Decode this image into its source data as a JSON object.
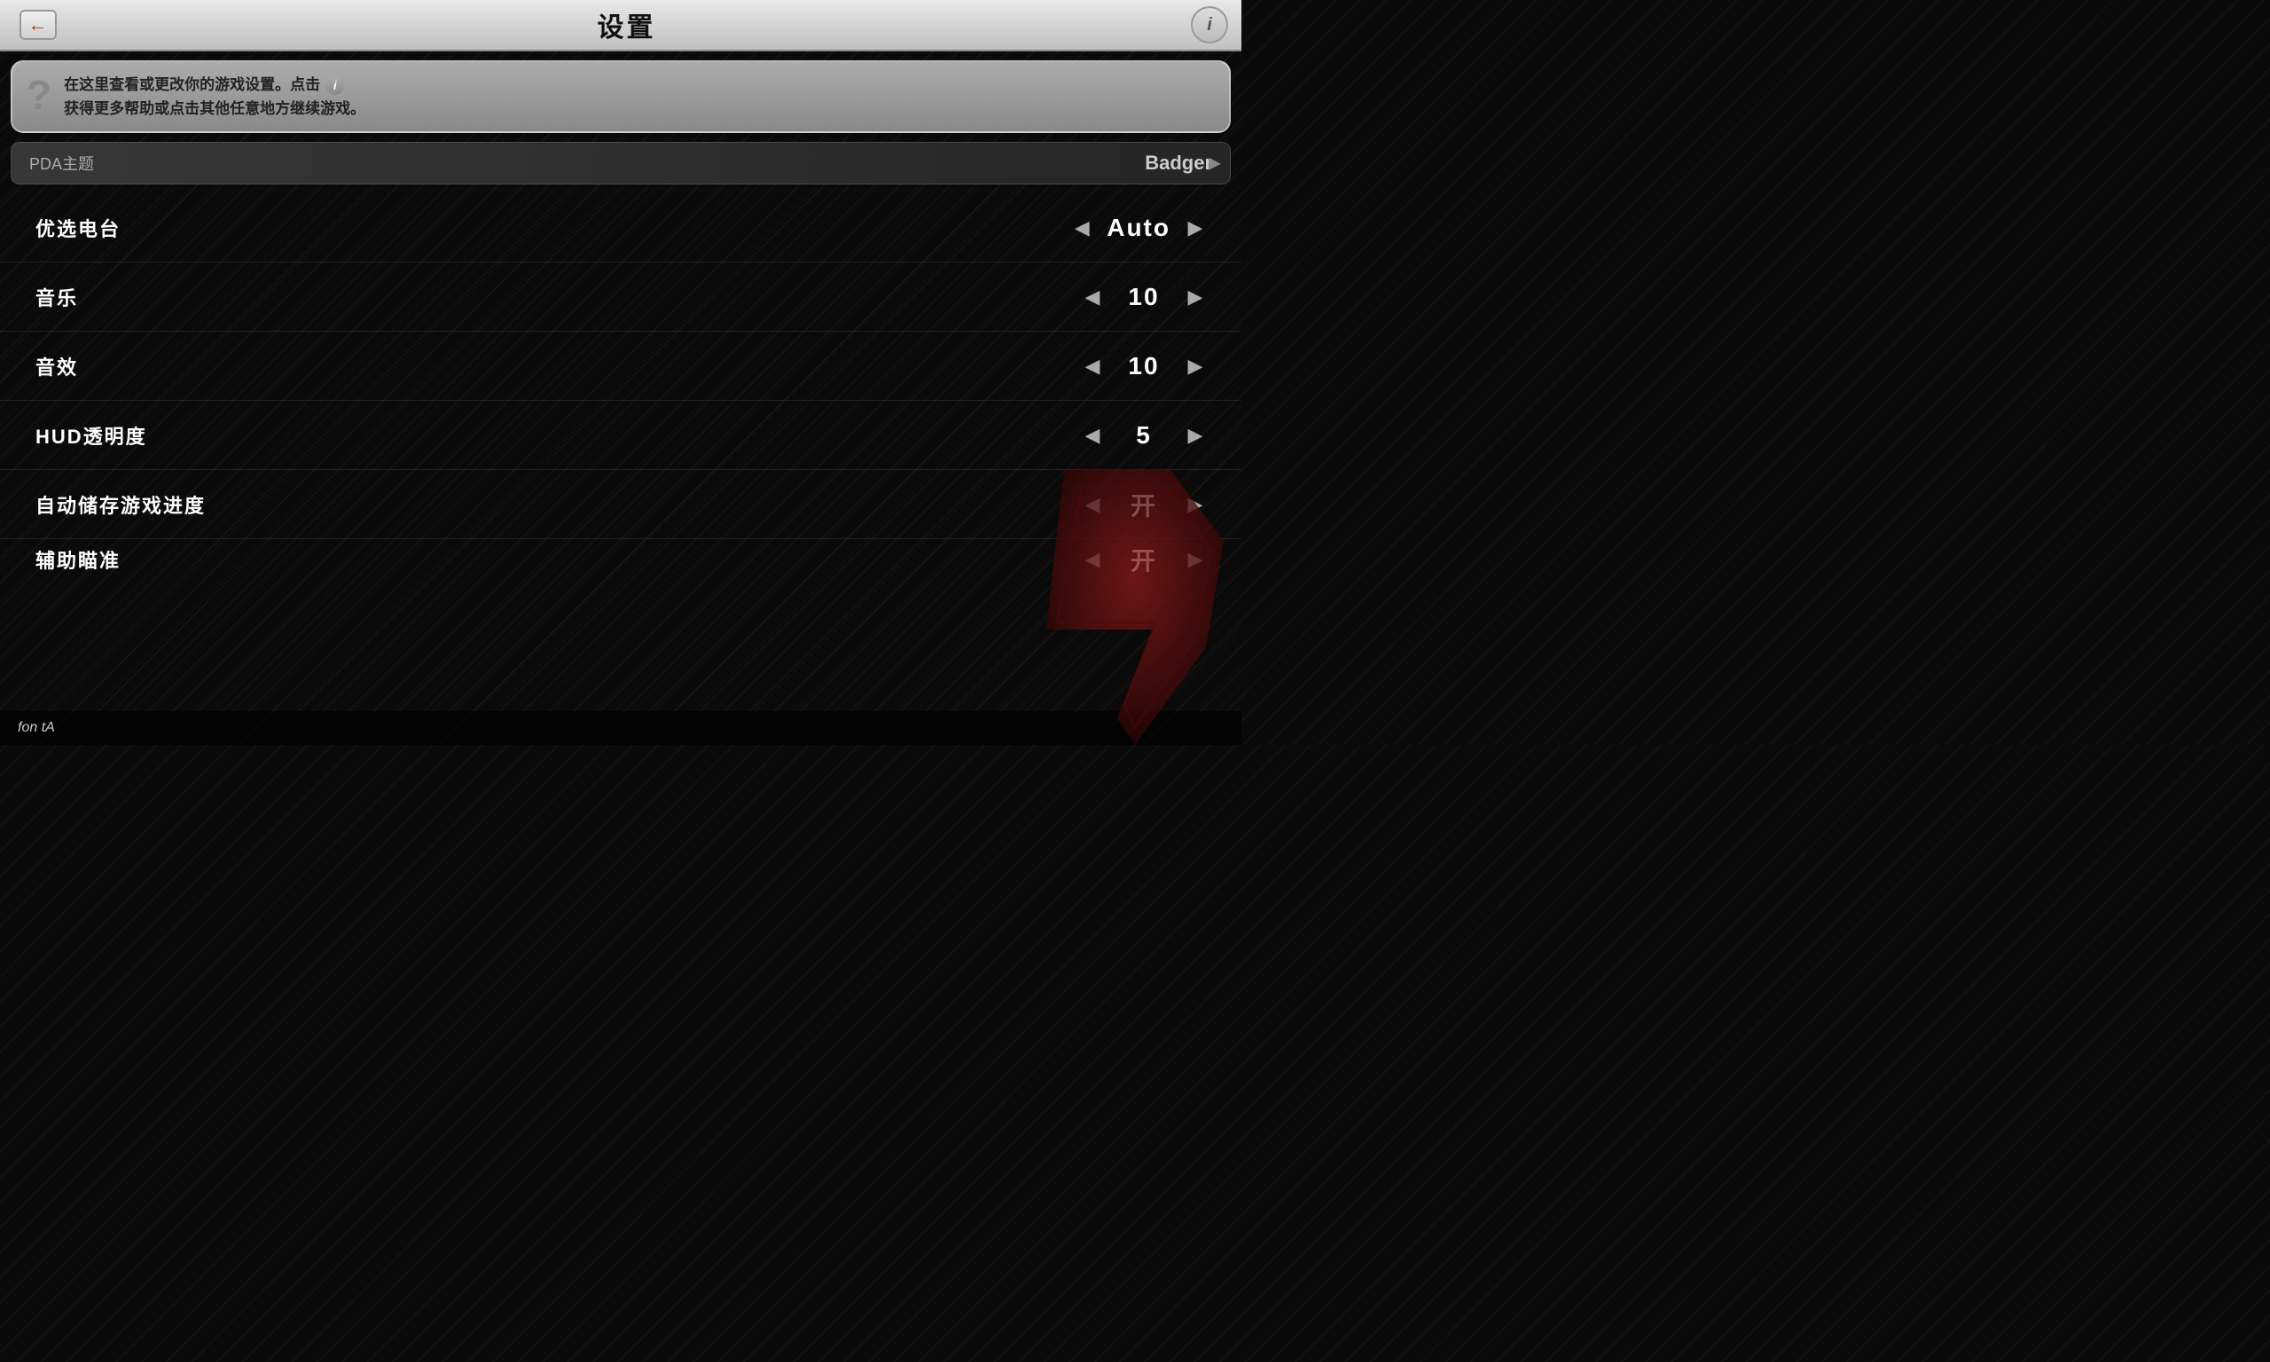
{
  "header": {
    "title": "设置",
    "back_label": "←",
    "info_label": "i"
  },
  "help": {
    "question_mark": "?",
    "text_line1": "在这里查看或更改你的游戏设置。点击",
    "text_line2": "获得更多帮助或点击其他任意地方继续游戏。"
  },
  "pda": {
    "label": "PDA主题",
    "value": "Badger",
    "arrow": "▶"
  },
  "settings": [
    {
      "label": "优选电台",
      "value": "Auto",
      "has_left": true,
      "has_right": true
    },
    {
      "label": "音乐",
      "value": "10",
      "has_left": true,
      "has_right": true
    },
    {
      "label": "音效",
      "value": "10",
      "has_left": true,
      "has_right": true
    },
    {
      "label": "HUD透明度",
      "value": "5",
      "has_left": true,
      "has_right": true
    },
    {
      "label": "自动储存游戏进度",
      "value": "开",
      "has_left": true,
      "has_right": true
    },
    {
      "label": "辅助瞄准",
      "value": "开",
      "has_left": true,
      "has_right": true
    }
  ],
  "bottom": {
    "text": "fon tA"
  },
  "arrows": {
    "left": "◀",
    "right": "▶"
  }
}
